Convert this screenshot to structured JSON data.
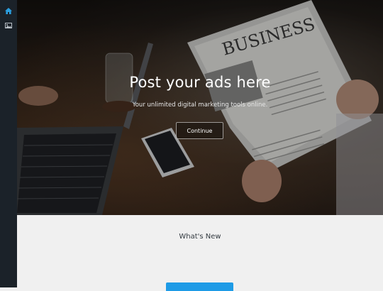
{
  "sidebar": {
    "items": [
      {
        "icon": "home-icon",
        "color": "#2b9fe0"
      },
      {
        "icon": "image-icon",
        "color": "#b9c0c7"
      }
    ]
  },
  "hero": {
    "title": "Post your ads here",
    "subtitle": "Your unlimited digital marketing tools online.",
    "button_label": "Continue",
    "newspaper_headline": "BUSINESS"
  },
  "section": {
    "title": "What's New",
    "button_color": "#1e9be6"
  }
}
